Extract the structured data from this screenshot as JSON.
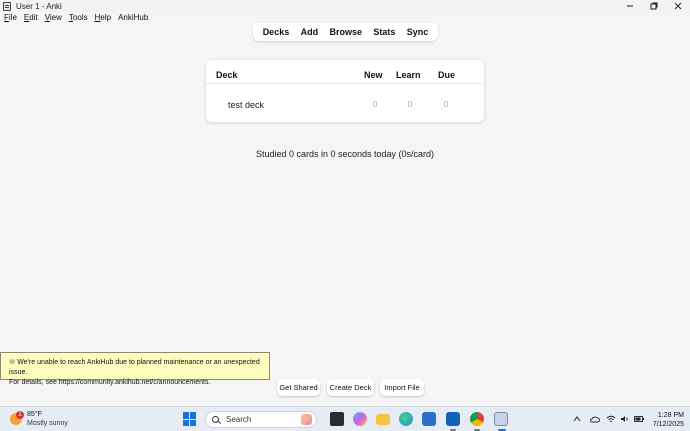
{
  "window": {
    "title": "User 1 - Anki"
  },
  "menu": {
    "items": [
      {
        "accel": "F",
        "rest": "ile"
      },
      {
        "accel": "E",
        "rest": "dit"
      },
      {
        "accel": "V",
        "rest": "iew"
      },
      {
        "accel": "T",
        "rest": "ools"
      },
      {
        "accel": "H",
        "rest": "elp"
      },
      {
        "accel": "",
        "rest": "AnkiHub"
      }
    ]
  },
  "toolbar": {
    "decks": "Decks",
    "add": "Add",
    "browse": "Browse",
    "stats": "Stats",
    "sync": "Sync"
  },
  "deck_table": {
    "headers": {
      "deck": "Deck",
      "new": "New",
      "learn": "Learn",
      "due": "Due"
    },
    "rows": [
      {
        "name": "test deck",
        "new": "0",
        "learn": "0",
        "due": "0"
      }
    ]
  },
  "studied_text": "Studied 0 cards in 0 seconds today (0s/card)",
  "notice": {
    "line1": "♾ We're unable to reach AnkiHub due to planned maintenance or an unexpected issue.",
    "line2": "For details, see https://community.ankihub.net/c/announcements."
  },
  "bottom_buttons": {
    "get_shared": "Get Shared",
    "create_deck": "Create Deck",
    "import_file": "Import File"
  },
  "taskbar": {
    "weather_badge": "1",
    "temperature": "85°F",
    "condition": "Mostly sunny",
    "search_placeholder": "Search",
    "time": "1:28 PM",
    "date": "7/12/2025",
    "apps": [
      {
        "name": "file-explorer-dark-icon",
        "color": "#2b2b2b"
      },
      {
        "name": "copilot-icon",
        "color": "#c266e0"
      },
      {
        "name": "folder-icon",
        "color": "#f4c542"
      },
      {
        "name": "edge-icon",
        "color": "#1d8fd6"
      },
      {
        "name": "store-icon",
        "color": "#2a6fc9"
      },
      {
        "name": "outlook-icon",
        "color": "#0f62b8"
      },
      {
        "name": "chrome-icon",
        "color": "#db4437"
      },
      {
        "name": "anki-icon",
        "color": "#c8d4e8"
      }
    ]
  }
}
